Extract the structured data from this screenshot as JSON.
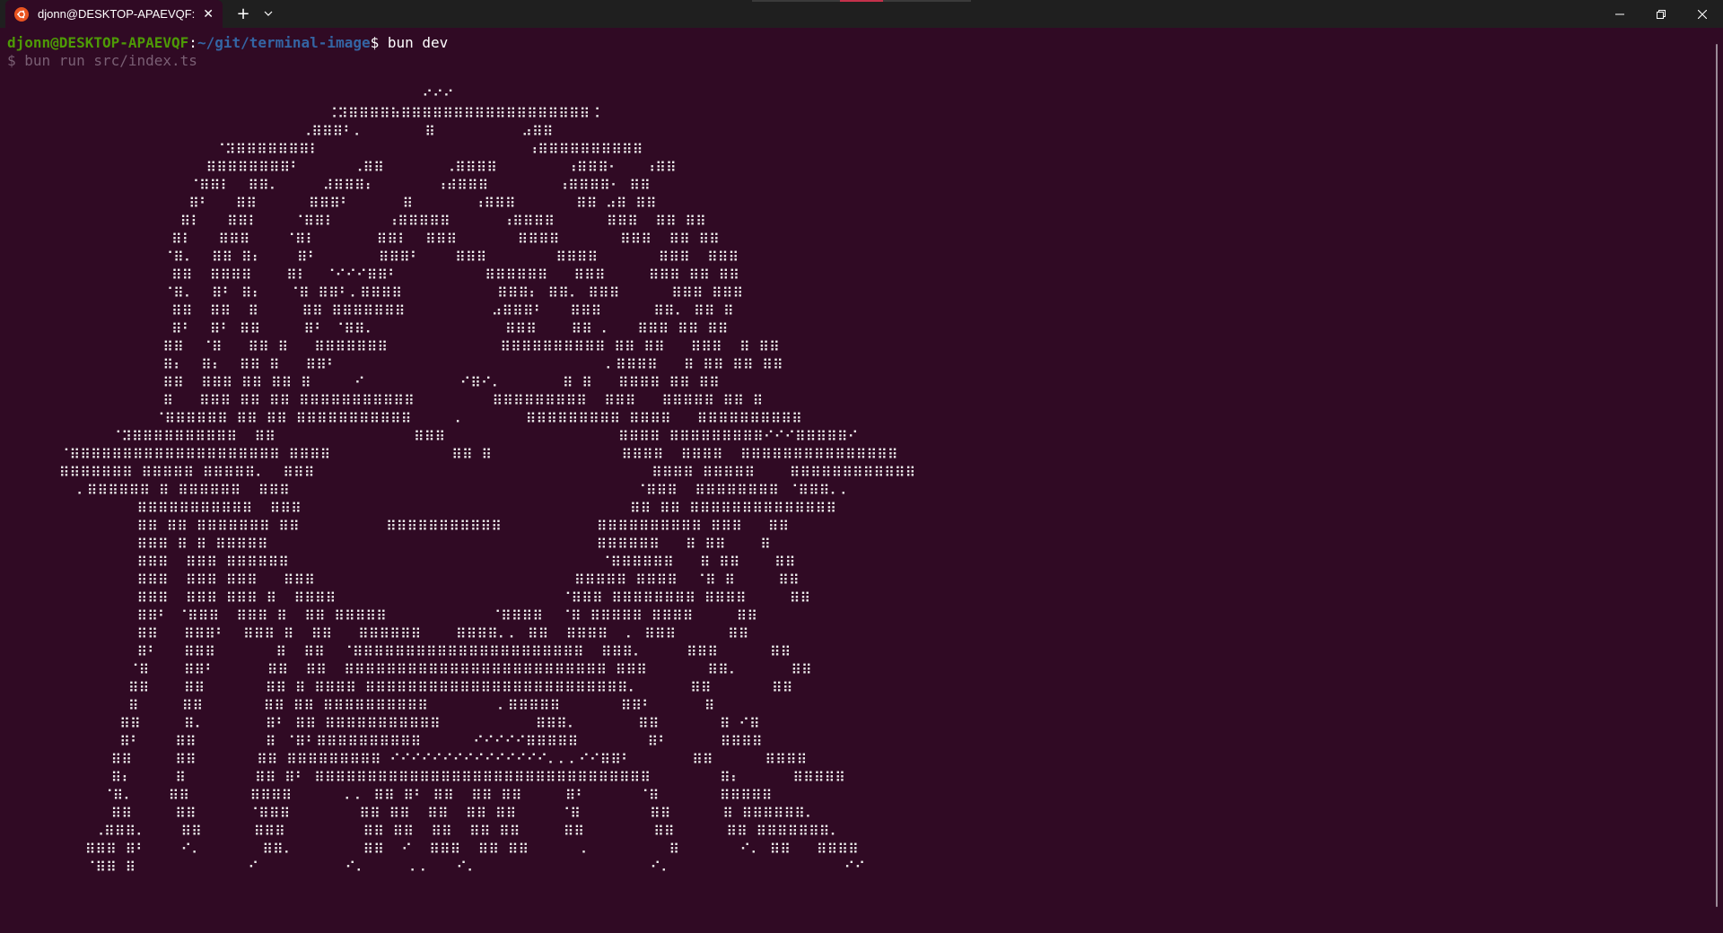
{
  "window": {
    "tab_title": "djonn@DESKTOP-APAEVQF: ~",
    "tab_icon": "ubuntu-icon",
    "new_tab_label": "+",
    "close_tab_label": "✕",
    "accent_color": "#e95420",
    "terminal_bg": "#300a24"
  },
  "terminal": {
    "prompt_user": "djonn@DESKTOP-APAEVQF",
    "prompt_sep": ":",
    "prompt_path": "~/git/terminal-image",
    "prompt_dollar": "$ ",
    "command": "bun dev",
    "echo_line": "$ bun run src/index.ts",
    "art_lines": [
      "                                                ⠊⠊⠊",
      "                                     ⠨⠽⠿⠿⠿⠿⠷⠿⠿⠿⠿⠿⠿⠿⠿⠿⠿⠿⠿⠿⠿⠿⠿⠿⠿⠨",
      "                                  ⠠⠿⠿⠿⠃⠄       ⠿          ⠴⠿⠿",
      "                        ⠈⠽⠿⠿⠿⠿⠿⠿⠿⠇                        ⠰⠿⠿⠿⠿⠿⠿⠿⠿⠿⠿",
      "                       ⠿⠿⠿⠿⠿⠿⠿⠿⠃      ⠠⠿⠿       ⠠⠿⠿⠿⠿        ⠰⠿⠿⠿⠂   ⠰⠿⠿",
      "                     ⠈⠿⠿⠇  ⠿⠿⠄     ⠼⠿⠿⠿⠆       ⠰⠾⠿⠿⠿        ⠰⠿⠿⠿⠿⠂ ⠿⠿",
      "                     ⠿⠃   ⠿⠿      ⠿⠿⠿⠃      ⠿       ⠰⠿⠿⠿       ⠿⠿ ⠴⠿ ⠿⠿",
      "                    ⠿⠇   ⠿⠿⠇    ⠈⠿⠿⠇      ⠰⠿⠿⠿⠿⠿      ⠰⠿⠿⠿⠿      ⠿⠿⠿  ⠿⠿ ⠿⠿",
      "                   ⠿⠇   ⠿⠿⠿    ⠈⠿⠇       ⠿⠿⠇  ⠿⠿⠿       ⠿⠿⠿⠿       ⠿⠿⠿  ⠿⠿ ⠿⠿",
      "                  ⠈⠿⠄  ⠿⠿ ⠿⠆    ⠿⠃       ⠿⠿⠿⠃    ⠿⠿⠿        ⠿⠿⠿⠿       ⠿⠿⠿  ⠿⠿⠿",
      "                   ⠿⠿  ⠿⠿⠿⠿    ⠿⠇  ⠈⠊⠊⠊⠿⠿⠃          ⠿⠿⠿⠿⠿⠿   ⠿⠿⠿     ⠿⠿⠿ ⠿⠿ ⠿⠿",
      "                  ⠈⠿⠄  ⠿⠃ ⠿⠆   ⠈⠿ ⠿⠿⠃⠄⠿⠿⠿⠿           ⠿⠿⠿⠆ ⠿⠿⠄ ⠿⠿⠿      ⠿⠿⠿ ⠿⠿⠿",
      "                   ⠿⠿  ⠿⠿  ⠿     ⠿⠿ ⠿⠿⠿⠿⠿⠿⠿          ⠴⠿⠿⠿⠃   ⠿⠿⠿      ⠿⠿⠄ ⠿⠿ ⠿",
      "                   ⠿⠃  ⠿⠃ ⠿⠿     ⠿⠃ ⠈⠿⠿⠄               ⠿⠿⠿    ⠿⠿ ⠄   ⠿⠿⠿ ⠿⠿ ⠿⠿",
      "                  ⠿⠿  ⠈⠿   ⠿⠿ ⠿   ⠿⠿⠿⠿⠿⠿⠿             ⠿⠿⠿⠿⠿⠿⠿⠿⠿⠿ ⠿⠿ ⠿⠿   ⠿⠿⠿  ⠿ ⠿⠿",
      "                  ⠿⠆  ⠿⠆  ⠿⠿ ⠿   ⠿⠿⠃                               ⠄⠿⠿⠿⠿   ⠿ ⠿⠿ ⠿⠿ ⠿⠿",
      "                  ⠿⠿  ⠿⠿⠿ ⠿⠿ ⠿⠿ ⠿     ⠊           ⠊⠿⠊⠄       ⠿ ⠿   ⠿⠿⠿⠿ ⠿⠿ ⠿⠿",
      "                  ⠿   ⠿⠿⠿ ⠿⠿ ⠿⠿ ⠿⠿⠿⠿⠿⠿⠿⠿⠿⠿⠿         ⠿⠿⠿⠿⠿⠿⠿⠿⠿  ⠿⠿⠿   ⠿⠿⠿⠿⠿ ⠿⠿ ⠿",
      "                 ⠈⠿⠿⠿⠿⠿⠿ ⠿⠿ ⠿⠿ ⠿⠿⠿⠿⠿⠿⠿⠿⠿⠿⠿     ⠄       ⠿⠿⠿⠿⠿⠿⠿⠿⠿ ⠿⠿⠿⠿   ⠿⠿⠿⠿⠿⠿⠿⠿⠿⠿",
      "            ⠈⠽⠿⠿⠿⠿⠿⠿⠿⠿⠿⠿  ⠿⠿                ⠿⠿⠿                    ⠿⠿⠿⠿ ⠿⠿⠿⠿⠿⠿⠿⠿⠿⠊⠊⠊⠿⠿⠿⠿⠿⠊",
      "      ⠈⠿⠿⠿⠿⠿⠿⠿⠿⠿⠿⠿⠿⠿⠿⠿⠿⠿⠿⠿⠿ ⠿⠿⠿⠿              ⠿⠿ ⠿               ⠿⠿⠿⠿  ⠿⠿⠿⠿  ⠿⠿⠿⠿⠿⠿⠿⠿⠿⠿⠿⠿⠿⠿⠿",
      "      ⠿⠿⠿⠿⠿⠿⠿ ⠿⠿⠿⠿⠿ ⠿⠿⠿⠿⠿⠄  ⠿⠿⠿                                       ⠿⠿⠿⠿ ⠿⠿⠿⠿⠿    ⠿⠿⠿⠿⠿⠿⠿⠿⠿⠿⠿⠿",
      "        ⠄⠿⠿⠿⠿⠿⠿ ⠿ ⠿⠿⠿⠿⠿⠿  ⠿⠿⠿                                        ⠈⠿⠿⠿  ⠿⠿⠿⠿⠿⠿⠿⠿ ⠈⠿⠿⠿⠄⠄",
      "               ⠿⠿⠿⠿⠿⠿⠿⠿⠿⠿⠿  ⠿⠿⠿                                      ⠿⠿ ⠿⠿ ⠿⠿⠿⠿⠿⠿⠿⠿⠿⠿⠿⠿⠿⠿",
      "               ⠿⠿ ⠿⠿ ⠿⠿⠿⠿⠿⠿⠿ ⠿⠿          ⠿⠿⠿⠿⠿⠿⠿⠿⠿⠿⠿           ⠿⠿⠿⠿⠿⠿⠿⠿⠿⠿ ⠿⠿⠿   ⠿⠿",
      "               ⠿⠿⠿ ⠿ ⠿ ⠿⠿⠿⠿⠿                                      ⠿⠿⠿⠿⠿⠿   ⠿ ⠿⠿    ⠿",
      "               ⠿⠿⠿  ⠿⠿⠿ ⠿⠿⠿⠿⠿⠿                                    ⠈⠿⠿⠿⠿⠿⠿   ⠿ ⠿⠿    ⠿⠿",
      "               ⠿⠿⠿  ⠿⠿⠿ ⠿⠿⠿   ⠿⠿⠿                              ⠿⠿⠿⠿⠿ ⠿⠿⠿⠿  ⠈⠿ ⠿     ⠿⠿",
      "               ⠿⠿⠿  ⠿⠿⠿ ⠿⠿⠿ ⠿  ⠿⠿⠿⠿                          ⠈⠿⠿⠿ ⠿⠿⠿⠿⠿⠿⠿⠿ ⠿⠿⠿⠿     ⠿⠿",
      "               ⠿⠿⠃ ⠈⠿⠿⠿  ⠿⠿⠿ ⠿  ⠿⠿ ⠿⠿⠿⠿⠿            ⠈⠿⠿⠿⠿  ⠈⠿ ⠿⠿⠿⠿⠿ ⠿⠿⠿⠿     ⠿⠿",
      "               ⠿⠿   ⠿⠿⠿⠃  ⠿⠿⠿ ⠿  ⠿⠿   ⠿⠿⠿⠿⠿⠿    ⠿⠿⠿⠿⠄⠄ ⠿⠿  ⠿⠿⠿⠿  ⠄ ⠿⠿⠿      ⠿⠿",
      "               ⠿⠃   ⠿⠿⠿       ⠿  ⠿⠿  ⠈⠿⠿⠿⠿⠿⠿⠿⠿⠿⠿⠿⠿⠿⠿⠿⠿⠿⠿⠿⠿⠿⠿  ⠿⠿⠿⠄     ⠿⠿⠿      ⠿⠿",
      "              ⠈⠿    ⠿⠿⠃      ⠿⠿  ⠿⠿  ⠿⠿⠿⠿⠿⠿⠿⠿⠿⠿⠿⠿⠿⠿⠿⠿⠿⠿⠿⠿⠿⠿⠿⠿⠿ ⠿⠿⠿       ⠿⠿⠄      ⠿⠿",
      "              ⠿⠿    ⠿⠿       ⠿⠿ ⠿ ⠿⠿⠿⠿ ⠿⠿⠿⠿⠿⠿⠿⠿⠿⠿⠿⠿⠿⠿⠿⠿⠿⠿⠿⠿⠿⠿⠿⠿⠿⠄      ⠿⠿       ⠿⠿",
      "              ⠿     ⠿⠿       ⠿⠿ ⠿⠿ ⠿⠿⠿⠿⠿⠿⠿⠿⠿⠿        ⠄⠿⠿⠿⠿⠿       ⠿⠿⠃      ⠿",
      "             ⠿⠿     ⠿⠄       ⠿⠃ ⠿⠿ ⠿⠿⠿⠿⠿⠿⠿⠿⠿⠿⠿           ⠿⠿⠿⠄       ⠿⠿       ⠿ ⠊⠿",
      "             ⠿⠃    ⠿⠿        ⠿ ⠈⠿⠃⠿⠿⠿⠿⠿⠿⠿⠿⠿⠿      ⠊⠊⠊⠊⠊⠿⠿⠿⠿⠿        ⠿⠃      ⠿⠿⠿⠿",
      "            ⠿⠿     ⠿⠿       ⠿⠿ ⠿⠿⠿⠿⠿⠿⠿⠿⠿ ⠊⠊⠊⠊⠊⠊⠊⠊⠊⠊⠊⠊⠊⠊⠊⠄⠄⠄⠊⠊⠿⠿⠃       ⠿⠿      ⠿⠿⠿⠿",
      "            ⠿⠆     ⠿        ⠿⠿ ⠿⠃ ⠿⠿⠿⠿⠿⠿⠿⠿⠿⠿⠿⠿⠿⠿⠿⠿⠿⠿⠿⠿⠿⠿⠿⠿⠿⠿⠿⠿⠿⠿⠿⠿        ⠿⠆      ⠿⠿⠿⠿⠿",
      "           ⠈⠿⠄    ⠿⠿       ⠿⠿⠿⠿      ⠄⠄ ⠿⠿ ⠿⠃ ⠿⠿  ⠿⠿ ⠿⠿     ⠿⠃      ⠈⠿       ⠿⠿⠿⠿⠿",
      "            ⠿⠿     ⠿⠿      ⠈⠿⠿⠿        ⠿⠿ ⠿⠿  ⠿⠿  ⠿⠿ ⠿⠿     ⠈⠿        ⠿⠿      ⠿ ⠿⠿⠿⠿⠿⠿⠄",
      "          ⠠⠿⠿⠿⠄    ⠿⠿      ⠿⠿⠿         ⠿⠿ ⠿⠿  ⠿⠿  ⠿⠿ ⠿⠿     ⠿⠿        ⠿⠿      ⠿⠿ ⠿⠿⠿⠿⠿⠿⠿⠄",
      "         ⠿⠿⠿ ⠿⠃    ⠊⠄       ⠿⠿⠄        ⠿⠿  ⠊  ⠿⠿⠿  ⠿⠿ ⠿⠿      ⠄         ⠿       ⠊⠄ ⠿⠿   ⠿⠿⠿⠿",
      "         ⠈⠿⠿ ⠿             ⠊          ⠊⠄     ⠄⠄   ⠊⠄                    ⠊⠄                    ⠊⠊"
    ]
  }
}
